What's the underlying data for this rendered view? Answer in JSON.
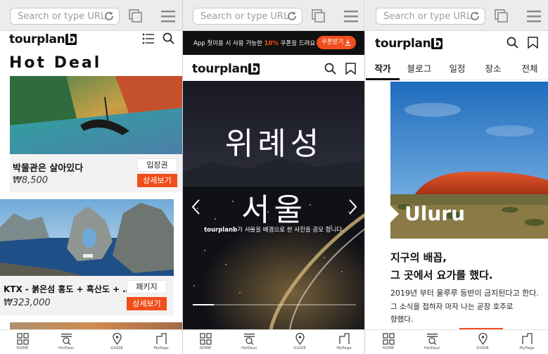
{
  "browser": {
    "url_placeholder": "Search or type URL"
  },
  "colors": {
    "accent": "#f04e1b",
    "dark_bg": "#0d0f18"
  },
  "panel1": {
    "logo_text": "tourplan",
    "logo_b": "b",
    "heading": "Hot Deal",
    "cards": [
      {
        "title": "박물관은 살아있다",
        "price": "₩8,500",
        "tag": "입장권",
        "action": "상세보기"
      },
      {
        "title": "KTX - 붉은섬 홍도 + 흑산도 + …",
        "price": "₩323,000",
        "tag": "패키지",
        "action": "상세보기"
      }
    ]
  },
  "panel2": {
    "banner_prefix": "App 첫이용 시 사용 가능한 ",
    "banner_highlight": "10%",
    "banner_suffix": " 쿠폰을 드려요",
    "banner_button": "쿠폰받기",
    "logo_text": "tourplan",
    "logo_b": "b",
    "hero_title_1": "위례성",
    "hero_title_2": "서울",
    "hero_caption_brand": "tourplanb",
    "hero_caption": "가 서울을 배경으로 한 사진을 공모 합니다."
  },
  "panel3": {
    "logo_text": "tourplan",
    "logo_b": "b",
    "tabs": [
      "작가",
      "블로그",
      "일정",
      "장소",
      "전체"
    ],
    "active_tab": "작가",
    "photo_label": "Uluru",
    "article_title_1": "지구의 배꼽,",
    "article_title_2": "그 곳에서 요가를 했다.",
    "article_body_1": "2019년 부터 울루루 등반이 금지된다고 한다.",
    "article_body_2": "그 소식을 접하자 마자 나는 곧장 호주로",
    "article_body_3": "향했다."
  },
  "bottom_nav": [
    "HOME",
    "HotDeal",
    "GUIDE",
    "MyPage"
  ]
}
